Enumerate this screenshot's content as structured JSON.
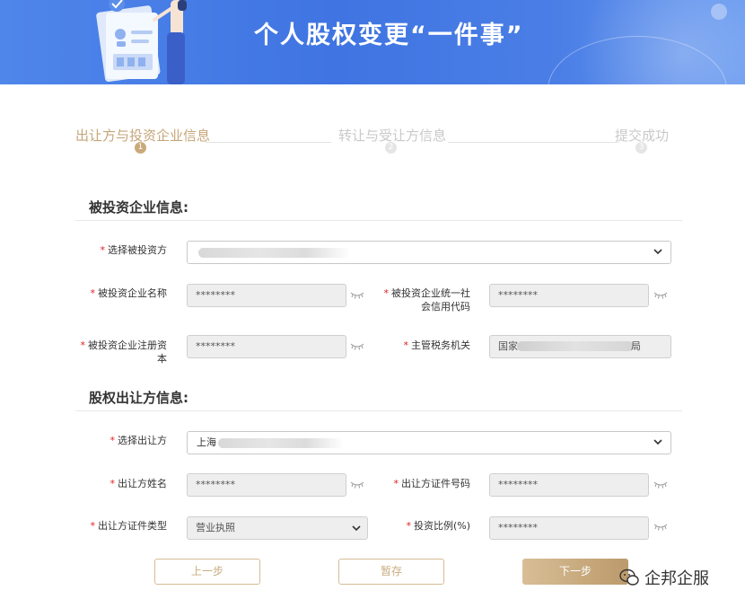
{
  "banner": {
    "title": "个人股权变更“一件事”"
  },
  "steps": [
    {
      "label": "出让方与投资企业信息",
      "num": "1",
      "active": true
    },
    {
      "label": "转让与受让方信息",
      "num": "2",
      "active": false
    },
    {
      "label": "提交成功",
      "num": "3",
      "active": false
    }
  ],
  "section1": {
    "title": "被投资企业信息:",
    "select_investee": {
      "label": "选择被投资方"
    },
    "company_name": {
      "label": "被投资企业名称",
      "value": "********"
    },
    "credit_code": {
      "label_line1": "被投资企业统一社",
      "label_line2": "会信用代码",
      "value": "********"
    },
    "reg_capital": {
      "label_line1": "被投资企业注册资",
      "label_line2": "本",
      "value": "********"
    },
    "tax_authority": {
      "label": "主管税务机关",
      "value_start": "国家",
      "value_end": "局"
    }
  },
  "section2": {
    "title": "股权出让方信息:",
    "select_transferor": {
      "label": "选择出让方",
      "value": "上海"
    },
    "transferor_name": {
      "label": "出让方姓名",
      "value": "********"
    },
    "transferor_id": {
      "label": "出让方证件号码",
      "value": "********"
    },
    "id_type": {
      "label": "出让方证件类型",
      "value": "营业执照"
    },
    "ratio": {
      "label": "投资比例(%)",
      "value": "********"
    }
  },
  "buttons": {
    "prev": "上一步",
    "save": "暂存",
    "next": "下一步"
  },
  "watermark": {
    "text": "企邦企服"
  },
  "required_mark": "*",
  "colors": {
    "banner": "#4a7de6",
    "accent": "#c9a97b",
    "required": "#e02020"
  }
}
